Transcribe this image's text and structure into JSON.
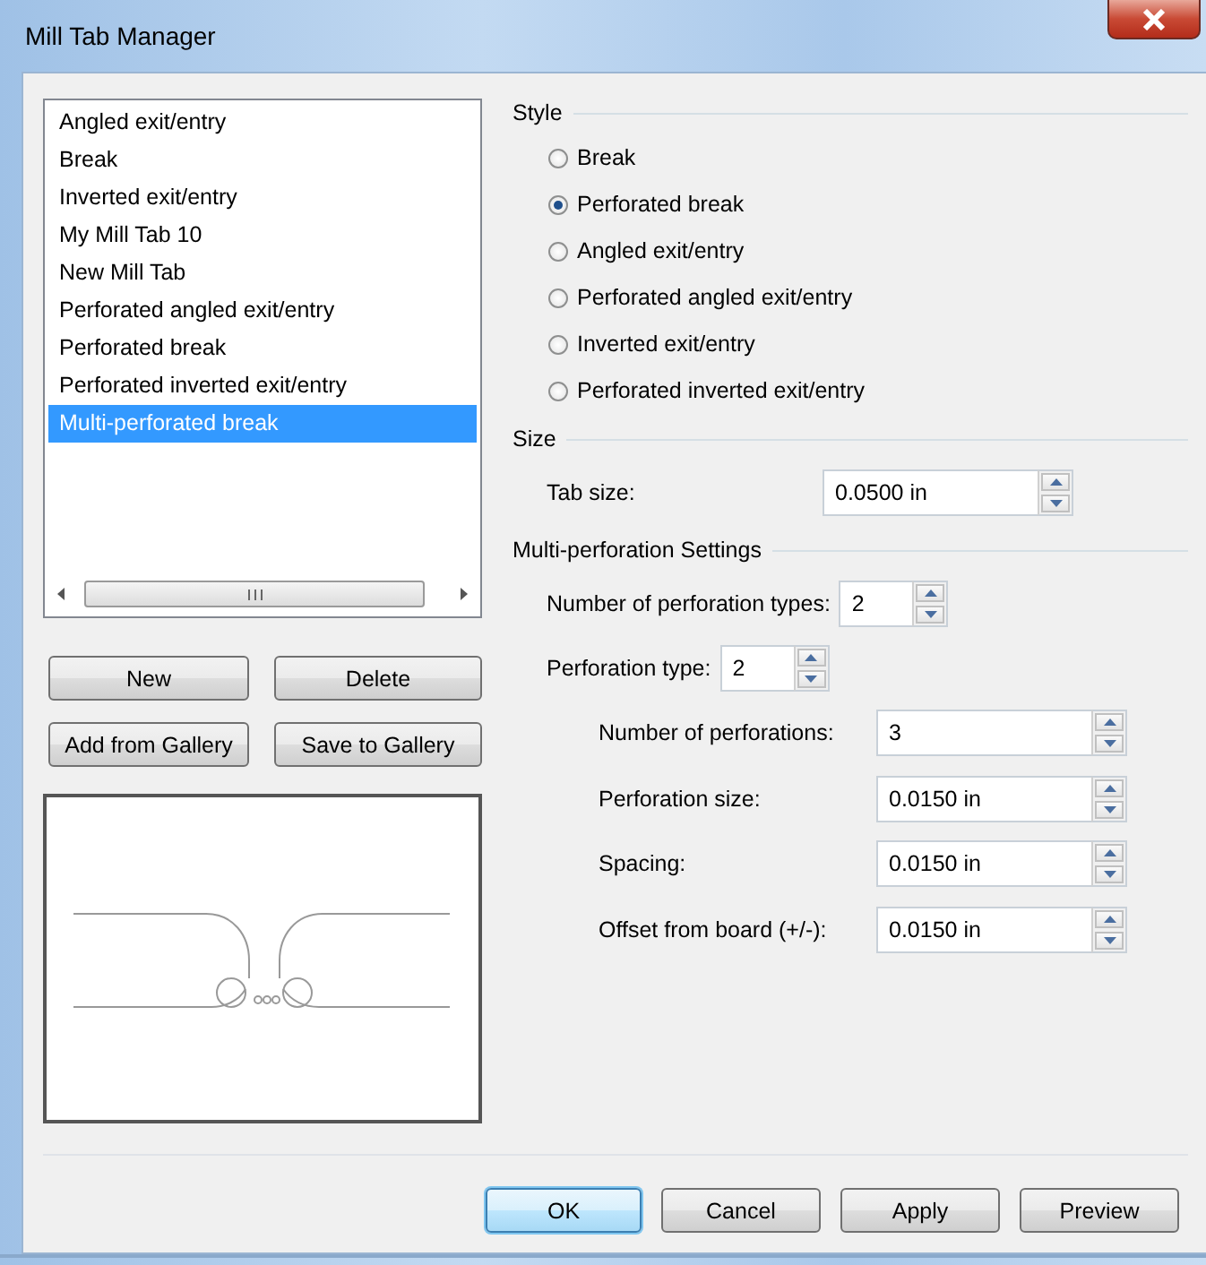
{
  "window": {
    "title": "Mill Tab Manager"
  },
  "tab_list": {
    "items": [
      {
        "label": "Angled exit/entry",
        "selected": false
      },
      {
        "label": "Break",
        "selected": false
      },
      {
        "label": "Inverted exit/entry",
        "selected": false
      },
      {
        "label": "My Mill Tab 10",
        "selected": false
      },
      {
        "label": "New Mill Tab",
        "selected": false
      },
      {
        "label": "Perforated angled exit/entry",
        "selected": false
      },
      {
        "label": "Perforated break",
        "selected": false
      },
      {
        "label": "Perforated inverted exit/entry",
        "selected": false
      },
      {
        "label": "Multi-perforated break",
        "selected": true
      }
    ]
  },
  "list_buttons": [
    {
      "label": "New"
    },
    {
      "label": "Delete"
    },
    {
      "label": "Add from Gallery"
    },
    {
      "label": "Save to Gallery"
    }
  ],
  "style": {
    "heading": "Style",
    "options": [
      {
        "label": "Break",
        "selected": false
      },
      {
        "label": "Perforated break",
        "selected": true
      },
      {
        "label": "Angled exit/entry",
        "selected": false
      },
      {
        "label": "Perforated angled exit/entry",
        "selected": false
      },
      {
        "label": "Inverted exit/entry",
        "selected": false
      },
      {
        "label": "Perforated inverted exit/entry",
        "selected": false
      }
    ]
  },
  "size": {
    "heading": "Size",
    "label": "Tab size:",
    "value": "0.0500 in"
  },
  "multi_perforation": {
    "heading": "Multi-perforation Settings",
    "settings": [
      {
        "label": "Number of perforation types:",
        "value": "2"
      },
      {
        "label": "Perforation type:",
        "value": "2",
        "children": [
          {
            "label": "Number of perforations:",
            "value": "3"
          },
          {
            "label": "Perforation size:",
            "value": "0.0150 in"
          },
          {
            "label": "Spacing:",
            "value": "0.0150 in"
          },
          {
            "label": "Offset from board (+/-):",
            "value": "0.0150 in"
          }
        ]
      }
    ]
  },
  "dialog_buttons": [
    {
      "label": "OK",
      "default": true
    },
    {
      "label": "Cancel",
      "default": false
    },
    {
      "label": "Apply",
      "default": false
    },
    {
      "label": "Preview",
      "default": false
    }
  ]
}
